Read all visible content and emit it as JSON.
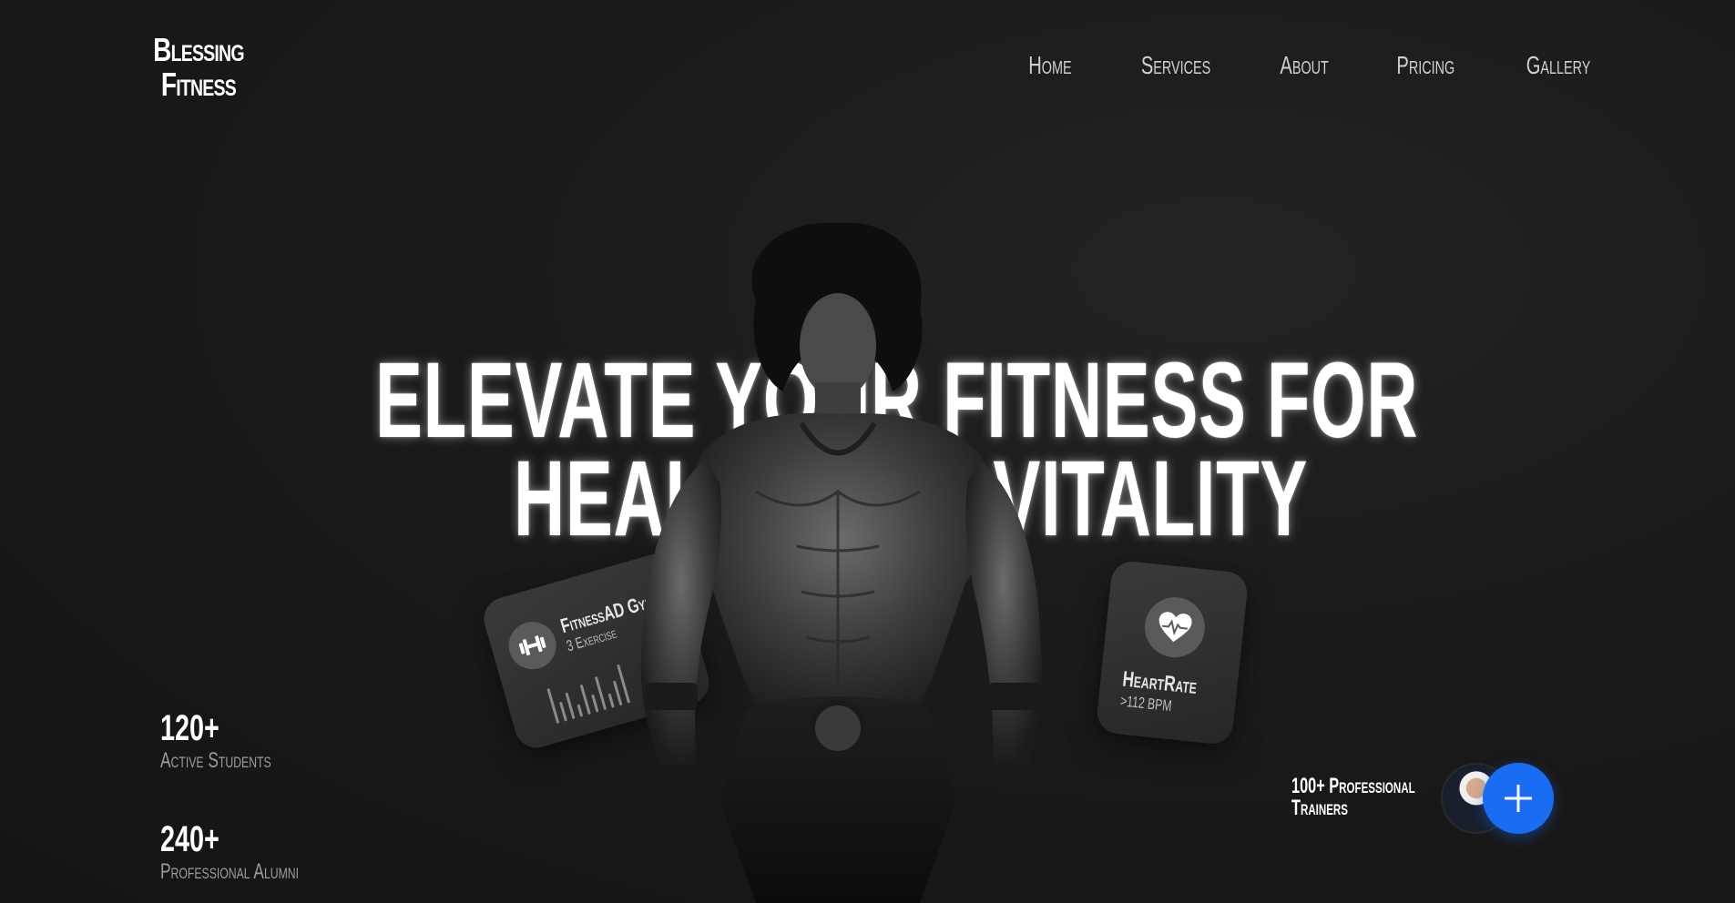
{
  "brand": {
    "line1": "Blessing",
    "line2": "Fitness"
  },
  "nav": {
    "items": [
      "Home",
      "Services",
      "About",
      "Pricing",
      "Gallery"
    ]
  },
  "hero": {
    "headline_line1": "ELEVATE YOUR FITNESS FOR",
    "headline_line2": "HEALTH AND VITALITY"
  },
  "card_gym": {
    "icon": "dumbbell-icon",
    "title": "FitnessAD Gym",
    "subtitle": "3 Exercise"
  },
  "card_heart": {
    "icon": "heart-pulse-icon",
    "title": "HeartRate",
    "subtitle": ">112 BPM"
  },
  "stats": [
    {
      "value": "120+",
      "label": "Active Students"
    },
    {
      "value": "240+",
      "label": "Professional Alumni"
    }
  ],
  "trainers": {
    "line1": "100+ Professional",
    "line2": "Trainers",
    "add_icon": "plus-icon"
  },
  "colors": {
    "background": "#161616",
    "accent": "#1a6df2",
    "card": "#2e2e2e",
    "muted_text": "#9d9d9d"
  }
}
